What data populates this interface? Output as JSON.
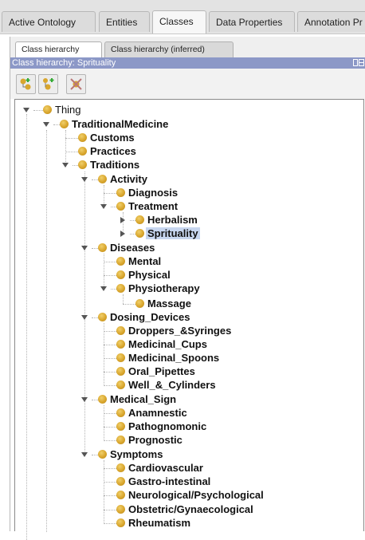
{
  "tabs": [
    {
      "label": "Active Ontology"
    },
    {
      "label": "Entities"
    },
    {
      "label": "Classes"
    },
    {
      "label": "Data Properties"
    },
    {
      "label": "Annotation Pr"
    }
  ],
  "subtabs": [
    {
      "label": "Class hierarchy"
    },
    {
      "label": "Class hierarchy (inferred)"
    }
  ],
  "panel_title": "Class hierarchy: Sprituality",
  "toolbar": {
    "icons": [
      "add-subclass-icon",
      "add-sibling-class-icon",
      "delete-class-icon"
    ]
  },
  "tree": {
    "thing": "Thing",
    "traditional_medicine": "TraditionalMedicine",
    "customs": "Customs",
    "practices": "Practices",
    "traditions": "Traditions",
    "activity": "Activity",
    "diagnosis": "Diagnosis",
    "treatment": "Treatment",
    "herbalism": "Herbalism",
    "sprituality": "Sprituality",
    "diseases": "Diseases",
    "mental": "Mental",
    "physical": "Physical",
    "physiotherapy": "Physiotherapy",
    "massage": "Massage",
    "dosing_devices": "Dosing_Devices",
    "droppers_syringes": "Droppers_&Syringes",
    "medicinal_cups": "Medicinal_Cups",
    "medicinal_spoons": "Medicinal_Spoons",
    "oral_pipettes": "Oral_Pipettes",
    "well_cylinders": "Well_&_Cylinders",
    "medical_sign": "Medical_Sign",
    "anamnestic": "Anamnestic",
    "pathognomonic": "Pathognomonic",
    "prognostic": "Prognostic",
    "symptoms": "Symptoms",
    "cardiovascular": "Cardiovascular",
    "gastro_intestinal": "Gastro-intestinal",
    "neurological_psychological": "Neurological/Psychological",
    "obstetric_gynaecological": "Obstetric/Gynaecological",
    "rheumatism": "Rheumatism"
  },
  "colors": {
    "title_bar": "#8c98c7",
    "selection": "#c7d6ef",
    "class_dot": "#d9a62d"
  }
}
